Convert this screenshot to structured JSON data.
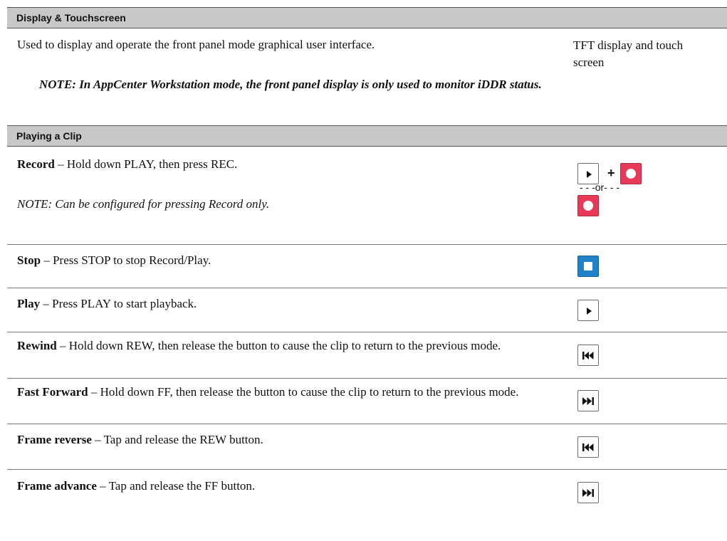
{
  "display_section": {
    "header": "Display & Touchscreen",
    "description": "Used to display and operate the front panel mode graphical user interface.",
    "note": "NOTE: In AppCenter Workstation mode, the front panel display is only used to monitor iDDR status.",
    "control": "TFT display and touch screen"
  },
  "playing_section": {
    "header": "Playing a Clip",
    "rows": [
      {
        "term": "Record",
        "text": " – Hold down PLAY, then press REC.",
        "note": "NOTE: Can be configured for pressing Record only.",
        "icon": "play-plus-record-icon"
      },
      {
        "term": "Stop",
        "text": " – Press STOP to stop Record/Play.",
        "icon": "stop-icon"
      },
      {
        "term": "Play",
        "text": " – Press PLAY to start playback.",
        "icon": "play-icon"
      },
      {
        "term": "Rewind",
        "text": " – Hold down REW, then release the button to cause the clip to return to the previous mode.",
        "icon": "rewind-icon"
      },
      {
        "term": "Fast Forward",
        "text": " – Hold down FF, then release the button to cause the clip to return to the previous mode.",
        "icon": "fast-forward-icon"
      },
      {
        "term": "Frame reverse",
        "text": " – Tap and release the REW button.",
        "icon": "rewind-icon"
      },
      {
        "term": "Frame advance",
        "text": " – Tap and release the FF button.",
        "icon": "fast-forward-icon"
      }
    ],
    "plus_symbol": "+",
    "or_separator": "- - -or- - -"
  },
  "colors": {
    "header_bg": "#c8c8c8",
    "record_red": "#e83a58",
    "stop_blue": "#1f82c9"
  }
}
